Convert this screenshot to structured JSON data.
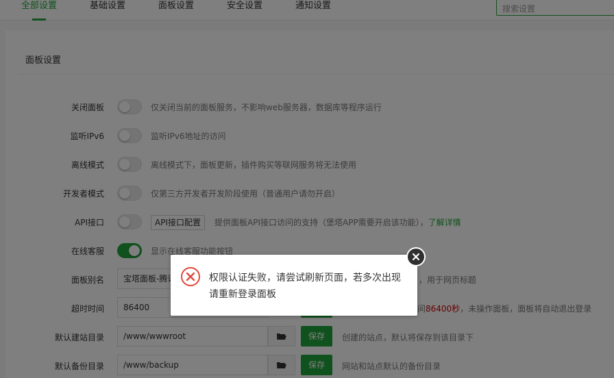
{
  "tabs": [
    {
      "label": "全部设置",
      "active": true
    },
    {
      "label": "基础设置"
    },
    {
      "label": "面板设置"
    },
    {
      "label": "安全设置"
    },
    {
      "label": "通知设置"
    }
  ],
  "search": {
    "placeholder": "搜索设置"
  },
  "section": {
    "title": "面板设置"
  },
  "rows": {
    "close_panel": {
      "label": "关闭面板",
      "enabled": false,
      "desc": "仅关闭当前的面板服务，不影响web服务器，数据库等程序运行"
    },
    "ipv6": {
      "label": "监听IPv6",
      "enabled": false,
      "desc": "监听IPv6地址的访问"
    },
    "offline": {
      "label": "离线模式",
      "enabled": false,
      "desc": "离线模式下，面板更新，插件购买等联网服务将无法使用"
    },
    "developer": {
      "label": "开发者模式",
      "enabled": false,
      "desc": "仅第三方开发者开发阶段使用（普通用户请勿开启）"
    },
    "api": {
      "label": "API接口",
      "enabled": false,
      "button": "API接口配置",
      "desc": "提供面板API接口访问的支持（堡塔APP需要开启该功能），",
      "link": "了解详情"
    },
    "online_service": {
      "label": "在线客服",
      "enabled": true,
      "desc": "显示在线客服功能按钮"
    },
    "alias": {
      "label": "面板别名",
      "value": "宝塔面板-腾讯",
      "desc": "，用于网页标题"
    },
    "timeout": {
      "label": "超时时间",
      "value": "86400",
      "desc_prefix": "间",
      "desc_red": "86400秒",
      "desc_suffix": "，未操作面板，面板将自动退出登录"
    },
    "site_dir": {
      "label": "默认建站目录",
      "value": "/www/wwwroot",
      "save": "保存",
      "desc": "创建的站点，默认将保存到该目录下"
    },
    "backup_dir": {
      "label": "默认备份目录",
      "value": "/www/backup",
      "save": "保存",
      "desc": "网站和站点默认的备份目录"
    }
  },
  "dialog": {
    "line1": "权限认证失败，请尝试刷新页面，若多次出现",
    "line2": "请重新登录面板",
    "icon": "error-circle-icon"
  },
  "colors": {
    "accent": "#20a53a",
    "error": "#e0463a"
  }
}
